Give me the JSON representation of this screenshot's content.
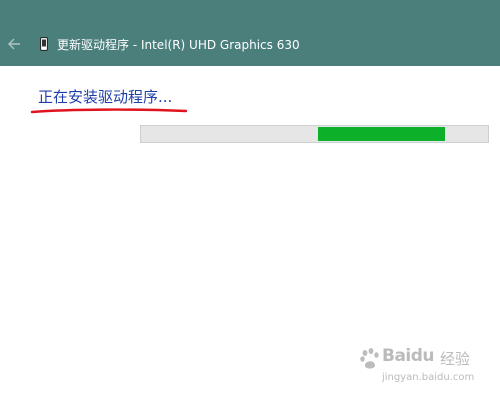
{
  "window": {
    "title": "更新驱动程序 - Intel(R) UHD Graphics 630",
    "back_icon": "back-arrow-icon",
    "device_icon": "device-icon"
  },
  "main": {
    "heading": "正在安装驱动程序...",
    "progress": {
      "indeterminate": true,
      "fill_start_fraction": 0.51,
      "fill_end_fraction": 0.875
    }
  },
  "annotation": {
    "underline_color": "#e0141e"
  },
  "watermark": {
    "brand": "Baidu",
    "product": "经验",
    "url": "jingyan.baidu.com"
  },
  "colors": {
    "titlebar": "#4a7f7c",
    "heading": "#1f3fa8",
    "progress_fill": "#0cb029",
    "progress_track": "#e6e6e6"
  }
}
